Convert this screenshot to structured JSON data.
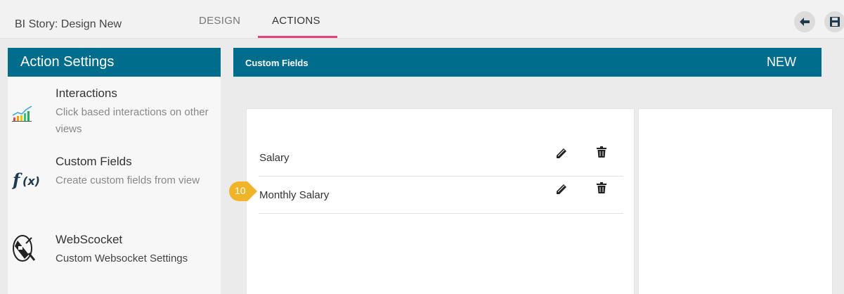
{
  "topbar": {
    "title": "BI Story: Design New",
    "tabs": [
      {
        "label": "DESIGN",
        "active": false
      },
      {
        "label": "ACTIONS",
        "active": true
      }
    ],
    "back_icon": "arrow-left-icon",
    "save_icon": "save-icon"
  },
  "sidebar": {
    "title": "Action Settings",
    "items": [
      {
        "title": "Interactions",
        "description": "Click based interactions on other views",
        "icon": "bar-chart-icon"
      },
      {
        "title": "Custom Fields",
        "description": "Create custom fields from view",
        "icon": "function-icon"
      },
      {
        "title": "WebScocket",
        "description": "Custom Websocket Settings",
        "icon": "plug-icon"
      }
    ]
  },
  "main": {
    "title": "Custom Fields",
    "new_label": "NEW",
    "fields": [
      {
        "name": "Salary"
      },
      {
        "name": "Monthly Salary"
      }
    ],
    "step_badge": "10"
  },
  "colors": {
    "header": "#006d8c",
    "tab_underline": "#e8407a",
    "badge": "#f0b429"
  }
}
